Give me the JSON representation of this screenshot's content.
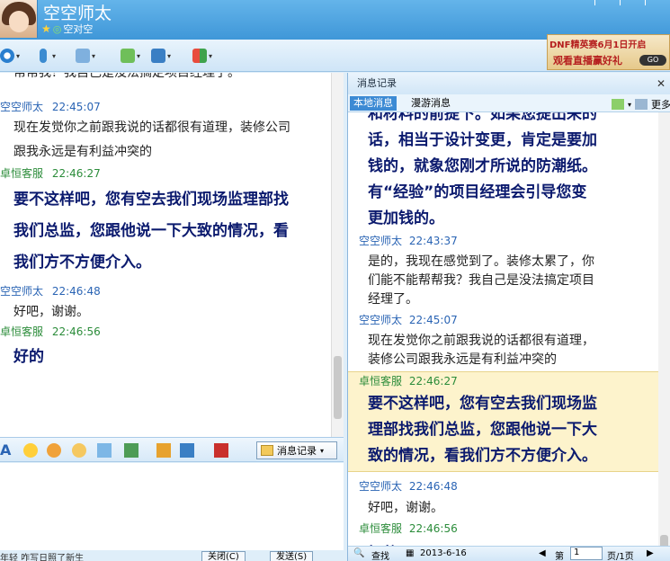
{
  "window": {
    "contact_name": "空空师太",
    "contact_status": "空对空"
  },
  "ad": {
    "line1": "DNF精英赛6月1日开启",
    "line2": "观看直播赢好礼",
    "go": "GO"
  },
  "chat": {
    "partial_top": "帮帮我？我自己是没法搞定项目经理了。",
    "messages": [
      {
        "sender": "空空师太",
        "time": "22:45:07",
        "text": [
          "现在发觉你之前跟我说的话都很有道理，装修公司",
          "跟我永远是有利益冲突的"
        ]
      },
      {
        "sender": "卓恒客服",
        "time": "22:46:27",
        "text": [
          "要不这样吧，您有空去我们现场监理部找",
          "我们总监，您跟他说一下大致的情况，看",
          "我们方不方便介入。"
        ]
      },
      {
        "sender": "空空师太",
        "time": "22:46:48",
        "text": [
          "好吧，谢谢。"
        ]
      },
      {
        "sender": "卓恒客服",
        "time": "22:46:56",
        "text": [
          "好的"
        ]
      }
    ]
  },
  "input_toolbar": {
    "font_icon": "A",
    "history_button": "消息记录"
  },
  "bottom_bar": {
    "status": "年轻  咋写日照了新生",
    "close_button": "关闭(C)",
    "send_button": "发送(S)"
  },
  "history": {
    "title": "消息记录",
    "tabs": [
      "本地消息",
      "漫游消息"
    ],
    "more": "更多",
    "partial_top": [
      "和材料的前提下。如果您提出来的",
      "话，相当于设计变更，肯定是要加",
      "钱的，就象您刚才所说的防潮纸。",
      "有“经验”的项目经理会引导您变",
      "更加钱的。"
    ],
    "messages": [
      {
        "sender": "空空师太",
        "time": "22:43:37",
        "text": [
          "是的，我现在感觉到了。装修太累了，你",
          "们能不能帮帮我？我自己是没法搞定项目",
          "经理了。"
        ]
      },
      {
        "sender": "空空师太",
        "time": "22:45:07",
        "text": [
          "现在发觉你之前跟我说的话都很有道理，",
          "装修公司跟我永远是有利益冲突的"
        ]
      },
      {
        "sender": "卓恒客服",
        "time": "22:46:27",
        "text": [
          "要不这样吧，您有空去我们现场监",
          "理部找我们总监，您跟他说一下大",
          "致的情况，看我们方不方便介入。"
        ]
      },
      {
        "sender": "空空师太",
        "time": "22:46:48",
        "text": [
          "好吧，谢谢。"
        ]
      },
      {
        "sender": "卓恒客服",
        "time": "22:46:56",
        "text": [
          "好的"
        ]
      }
    ],
    "footer": {
      "search": "查找",
      "date": "2013-6-16",
      "page_prefix": "第",
      "page_value": "1",
      "page_suffix": "页/1页"
    }
  },
  "colors": {
    "title_bar": "#3f97d8",
    "customer_sender": "#2a64b4",
    "agent_sender": "#2b8c3a",
    "agent_message": "#0b1a6e",
    "highlight": "#fdf3cc"
  }
}
